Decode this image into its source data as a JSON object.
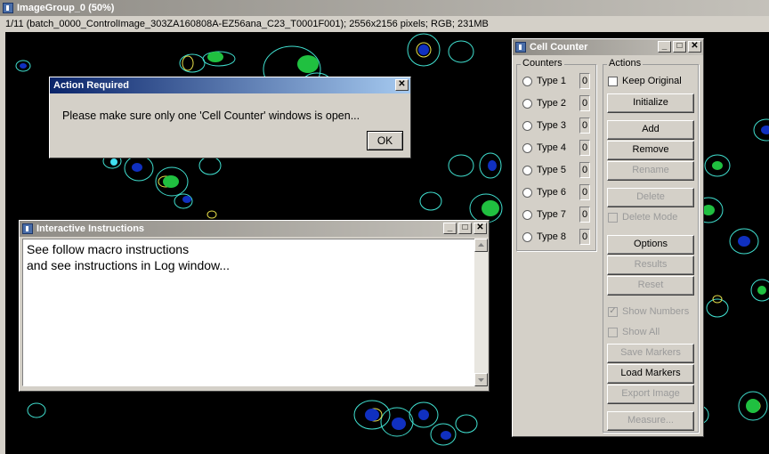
{
  "image_window": {
    "title": "ImageGroup_0 (50%)",
    "info": "1/11 (batch_0000_ControlImage_303ZA160808A-EZ56ana_C23_T0001F001); 2556x2156 pixels; RGB; 231MB"
  },
  "action_dialog": {
    "title": "Action Required",
    "message": "Please make sure only one 'Cell Counter' windows is open...",
    "ok_label": "OK",
    "close_glyph": "✕"
  },
  "instructions": {
    "title": "Interactive Instructions",
    "lines": [
      "See follow macro instructions",
      "and see instructions in Log window..."
    ]
  },
  "cell_counter": {
    "title": "Cell Counter",
    "counters_label": "Counters",
    "actions_label": "Actions",
    "counters": [
      {
        "label": "Type 1",
        "value": "0"
      },
      {
        "label": "Type 2",
        "value": "0"
      },
      {
        "label": "Type 3",
        "value": "0"
      },
      {
        "label": "Type 4",
        "value": "0"
      },
      {
        "label": "Type 5",
        "value": "0"
      },
      {
        "label": "Type 6",
        "value": "0"
      },
      {
        "label": "Type 7",
        "value": "0"
      },
      {
        "label": "Type 8",
        "value": "0"
      }
    ],
    "keep_original": "Keep Original",
    "initialize": "Initialize",
    "add": "Add",
    "remove": "Remove",
    "rename": "Rename",
    "delete": "Delete",
    "delete_mode": "Delete Mode",
    "options": "Options",
    "results": "Results",
    "reset": "Reset",
    "show_numbers": "Show Numbers",
    "show_all": "Show All",
    "save_markers": "Save Markers",
    "load_markers": "Load Markers",
    "export_image": "Export Image",
    "measure": "Measure..."
  },
  "window_buttons": {
    "minimize": "_",
    "maximize": "□",
    "close": "✕"
  },
  "colors": {
    "inactive_titlebar": "#8f8c86",
    "active_titlebar": "#0a246a",
    "image_background": "#000000",
    "cell_outline": "#40e0d0",
    "nucleus_blue": "#1030c0",
    "nucleus_green": "#20c040"
  }
}
